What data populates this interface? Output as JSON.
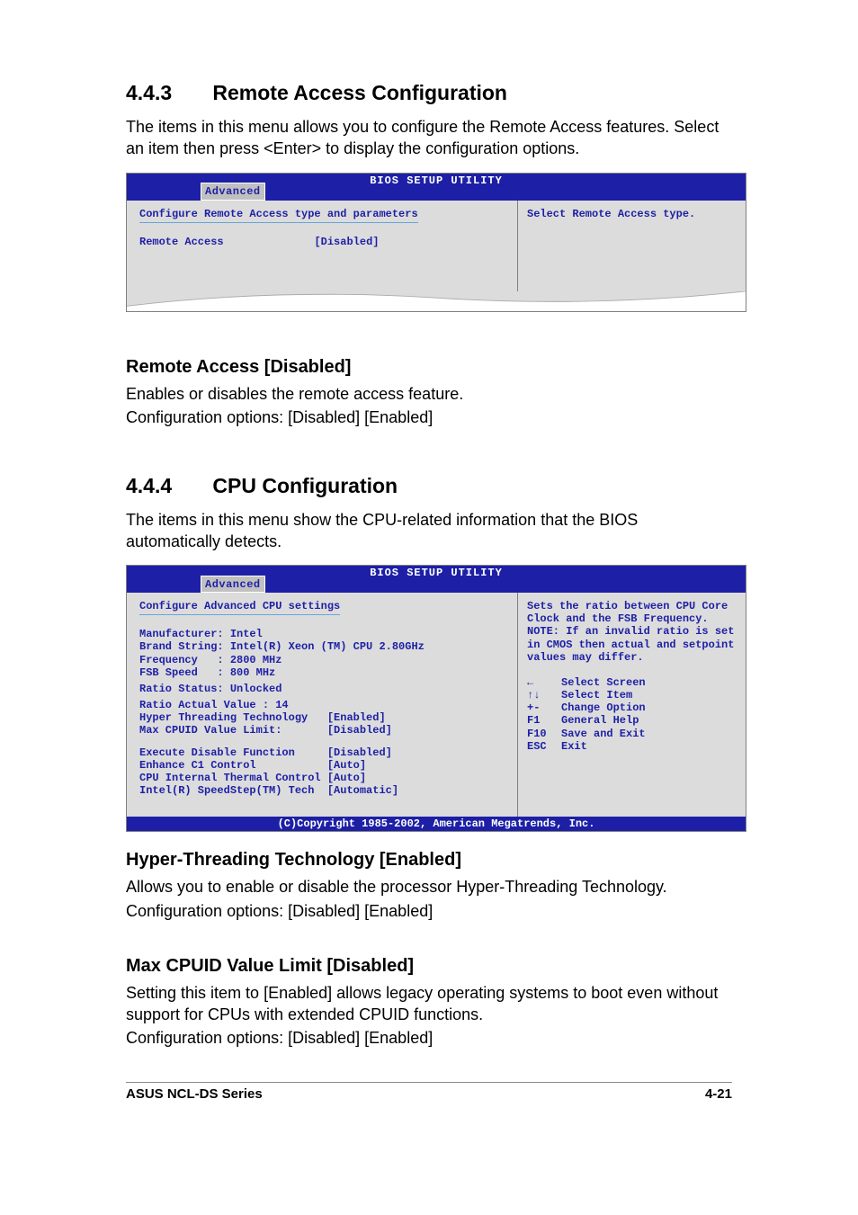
{
  "sec1": {
    "num": "4.4.3",
    "title": "Remote Access Configuration",
    "intro": "The items in this menu allows you to configure the Remote Access features. Select an item then press <Enter> to display the configuration options.",
    "sub1_title": "Remote Access [Disabled]",
    "sub1_p1": "Enables or disables the remote access feature.",
    "sub1_p2": "Configuration options: [Disabled] [Enabled]"
  },
  "sec2": {
    "num": "4.4.4",
    "title": "CPU Configuration",
    "intro": "The items in this menu show the CPU-related information that the BIOS automatically detects.",
    "sub1_title": "Hyper-Threading Technology [Enabled]",
    "sub1_p1": "Allows you to enable or disable the processor Hyper-Threading Technology.",
    "sub1_p2": "Configuration options: [Disabled] [Enabled]",
    "sub2_title": "Max CPUID Value Limit [Disabled]",
    "sub2_p1": "Setting this item to [Enabled] allows legacy operating systems to boot even without support for CPUs with extended CPUID functions.",
    "sub2_p2": "Configuration options: [Disabled] [Enabled]"
  },
  "bios1": {
    "utility_title": "BIOS SETUP UTILITY",
    "tab": "Advanced",
    "heading": "Configure Remote Access type and parameters",
    "row1_label": "Remote Access",
    "row1_value": "[Disabled]",
    "help": "Select Remote Access type."
  },
  "bios2": {
    "utility_title": "BIOS SETUP UTILITY",
    "tab": "Advanced",
    "heading": "Configure Advanced CPU settings",
    "info": {
      "l1": "Manufacturer: Intel",
      "l2": "Brand String: Intel(R) Xeon (TM) CPU 2.80GHz",
      "l3": "Frequency   : 2800 MHz",
      "l4": "FSB Speed   : 800 MHz",
      "l5": "Ratio Status: Unlocked",
      "l6": "Ratio Actual Value : 14"
    },
    "settings": {
      "s1_label": "Hyper Threading Technology",
      "s1_value": "[Enabled]",
      "s2_label": "Max CPUID Value Limit:",
      "s2_value": "[Disabled]",
      "s3_label": "Execute Disable Function",
      "s3_value": "[Disabled]",
      "s4_label": "Enhance C1 Control",
      "s4_value": "[Auto]",
      "s5_label": "CPU Internal Thermal Control",
      "s5_value": "[Auto]",
      "s6_label": "Intel(R) SpeedStep(TM) Tech",
      "s6_value": "[Automatic]"
    },
    "help": "Sets the ratio between CPU Core Clock and the FSB Frequency.\nNOTE: If an invalid ratio is set in CMOS then actual and setpoint values may differ.",
    "keys": {
      "k1": "←",
      "a1": "Select Screen",
      "k2": "↑↓",
      "a2": "Select Item",
      "k3": "+-",
      "a3": "Change Option",
      "k4": "F1",
      "a4": "General Help",
      "k5": "F10",
      "a5": "Save and Exit",
      "k6": "ESC",
      "a6": "Exit"
    },
    "footer": "(C)Copyright 1985-2002, American Megatrends, Inc."
  },
  "pagefoot": {
    "left": "ASUS NCL-DS Series",
    "right": "4-21"
  }
}
